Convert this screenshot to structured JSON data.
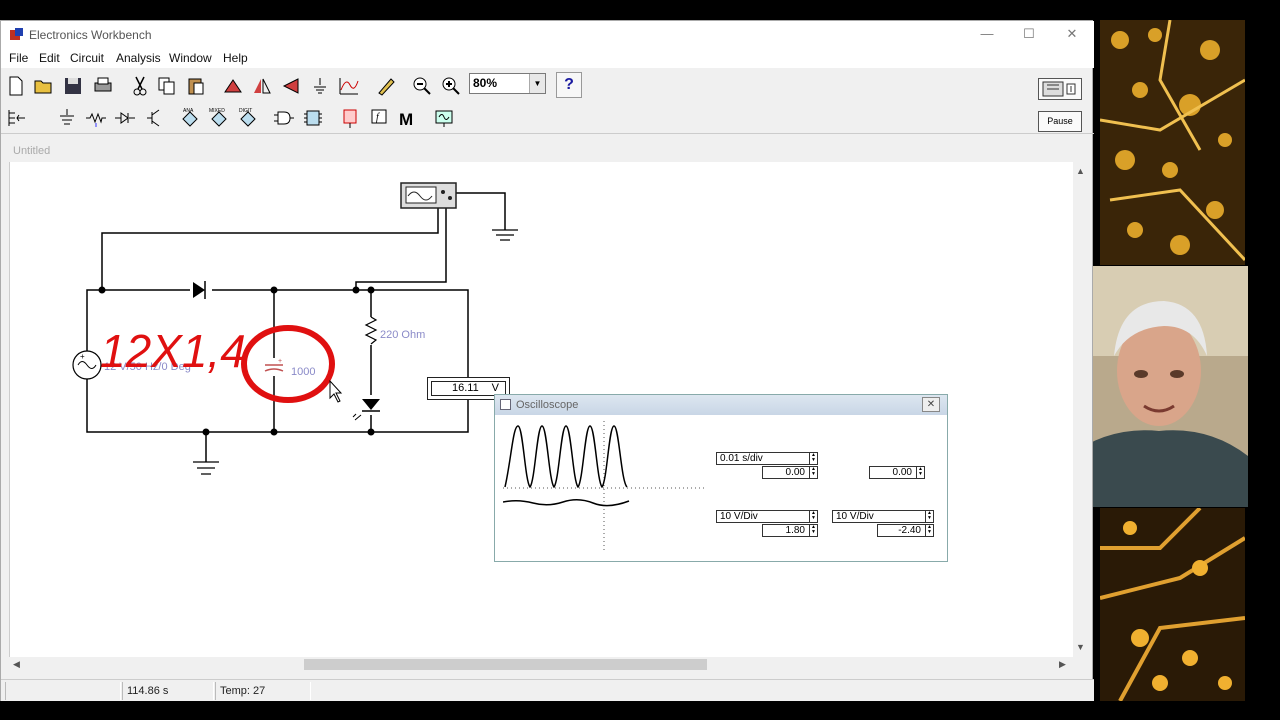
{
  "window": {
    "title": "Electronics Workbench"
  },
  "menu": {
    "items": [
      "File",
      "Edit",
      "Circuit",
      "Analysis",
      "Window",
      "Help"
    ]
  },
  "toolbar": {
    "zoom": "80%",
    "help_label": "?",
    "pause_label": "Pause",
    "bin_labels": {
      "analog": "ANA",
      "mixed": "MIXED",
      "digital": "DIGIT",
      "misc": "M"
    }
  },
  "document": {
    "title": "Untitled"
  },
  "circuit": {
    "source_label": "12 V/50 Hz/0 Deg",
    "capacitor_label": "1000",
    "resistor_label": "220  Ohm",
    "voltmeter_value": "16.11",
    "voltmeter_unit": "V",
    "annotation": "12X1,4"
  },
  "oscilloscope": {
    "title": "Oscilloscope",
    "timebase": "0.01 s/div",
    "x_position": "0.00",
    "trigger_level": "0.00",
    "channel_a_scale": "10 V/Div",
    "channel_a_position": "1.80",
    "channel_b_scale": "10 V/Div",
    "channel_b_position": "-2.40"
  },
  "status": {
    "time": "114.86 s",
    "temp": "Temp: 27"
  },
  "colors": {
    "annotation": "#e01010",
    "labels": "#8a8ac8",
    "wire": "#000000"
  }
}
